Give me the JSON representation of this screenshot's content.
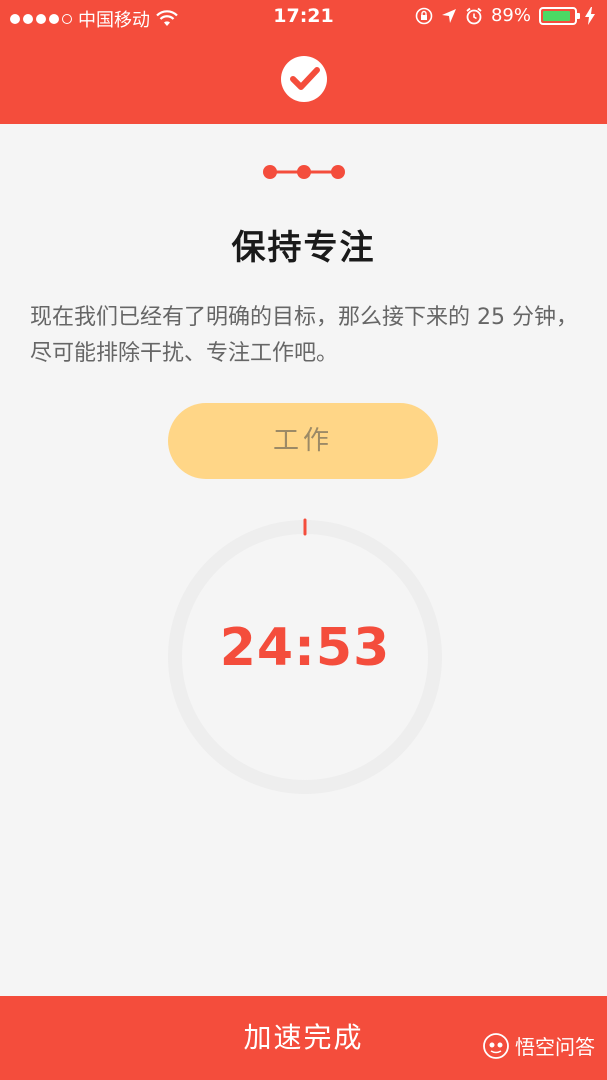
{
  "status_bar": {
    "carrier": "中国移动",
    "time": "17:21",
    "battery_percent": "89%",
    "battery_level": 0.89
  },
  "onboarding": {
    "current_step": 2,
    "total_steps": 3,
    "title": "保持专注",
    "description": "现在我们已经有了明确的目标，那么接下来的 25 分钟，尽可能排除干扰、专注工作吧。",
    "work_button_label": "工作"
  },
  "timer": {
    "time_remaining": "24:53",
    "progress": 0.005
  },
  "footer": {
    "finish_label": "加速完成"
  },
  "watermark": {
    "text": "悟空问答"
  },
  "colors": {
    "primary": "#f44d3c",
    "button_yellow": "#ffd687",
    "background": "#f5f5f5",
    "ring_track": "#eeeeee",
    "battery_green": "#4cd964"
  },
  "icons": {
    "logo": "check-circle-icon",
    "wifi": "wifi-icon",
    "lock": "rotation-lock-icon",
    "location": "location-arrow-icon",
    "alarm": "alarm-icon",
    "charging": "charging-bolt-icon",
    "watermark_logo": "wukong-logo-icon"
  }
}
